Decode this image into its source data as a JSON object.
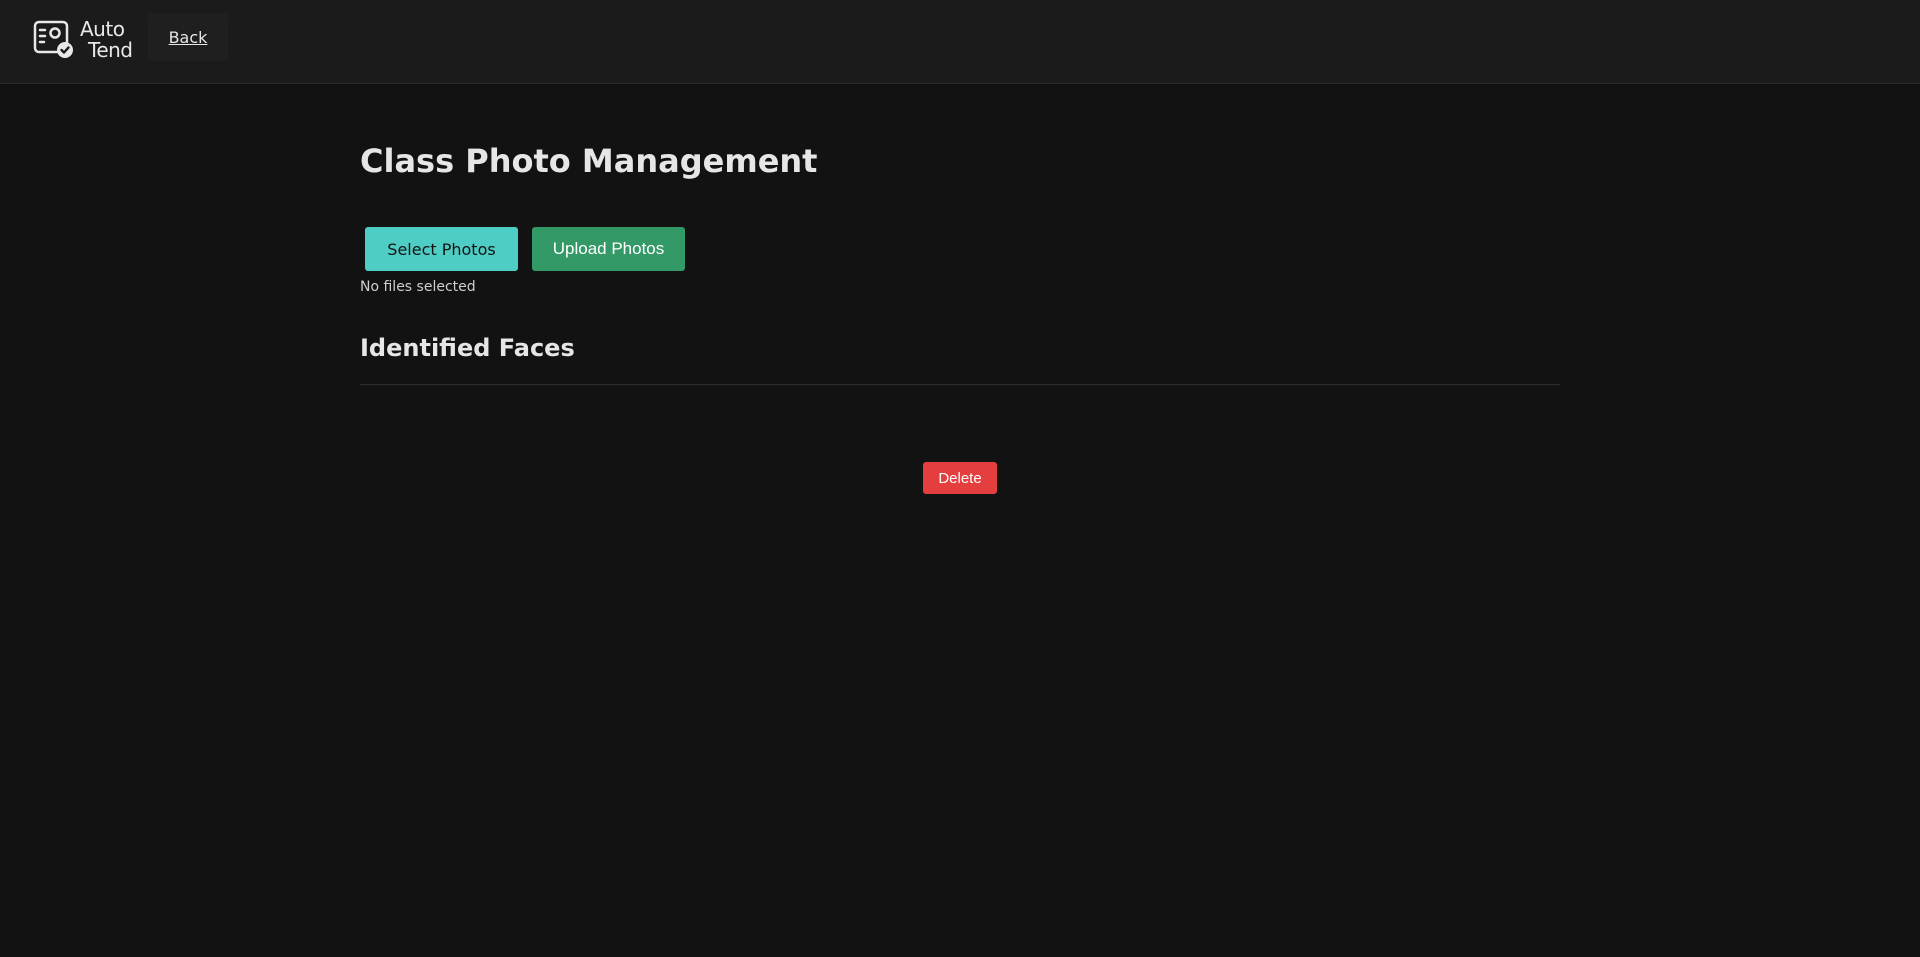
{
  "header": {
    "logo": {
      "line1": "Auto",
      "line2": "Tend",
      "icon": "id-card-check-icon"
    },
    "back_label": "Back"
  },
  "main": {
    "title": "Class Photo Management",
    "select_button_label": "Select Photos",
    "upload_button_label": "Upload Photos",
    "file_status": "No files selected",
    "section_title": "Identified Faces",
    "delete_button_label": "Delete"
  },
  "colors": {
    "background": "#121212",
    "topbar": "#1b1b1b",
    "select_button": "#4ecdc4",
    "upload_button": "#339966",
    "delete_button": "#e53e3e"
  }
}
